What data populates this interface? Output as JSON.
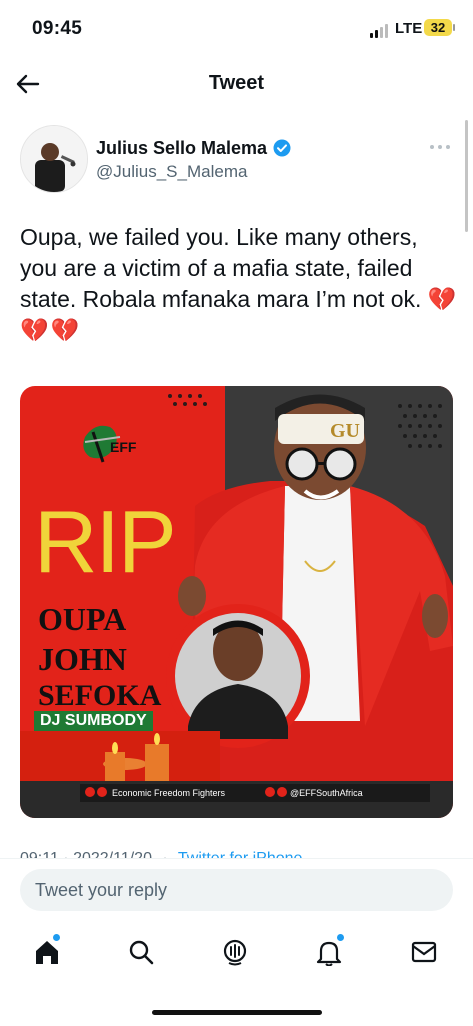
{
  "status_bar": {
    "time": "09:45",
    "network": "LTE",
    "battery": "32"
  },
  "header": {
    "title": "Tweet",
    "back_icon": "arrow-left-icon"
  },
  "tweet": {
    "author_name": "Julius Sello Malema",
    "author_handle": "@Julius_S_Malema",
    "text": "Oupa, we failed you. Like many others, you are a victim of a mafia state, failed state.  Robala mfanaka mara I’m not ok.",
    "emojis": "💔💔💔",
    "timestamp": "09:11 · 2022/11/20",
    "source": "Twitter for iPhone"
  },
  "media": {
    "party": "EFF",
    "headline": "RIP",
    "name_lines": [
      "OUPA",
      "JOHN",
      "SEFOKA"
    ],
    "alias": "DJ SUMBODY",
    "cap": "GU",
    "footer_left": "Economic Freedom Fighters",
    "footer_right": "@EFFSouthAfrica",
    "colors": {
      "red": "#e2231a",
      "dark": "#3a3a3a",
      "gold": "#f0d43a",
      "green": "#1f7a34"
    }
  },
  "reply": {
    "placeholder": "Tweet your reply"
  },
  "tabs": [
    "home-icon",
    "search-icon",
    "spaces-icon",
    "notifications-icon",
    "messages-icon"
  ],
  "accent_color": "#1d9bf0"
}
